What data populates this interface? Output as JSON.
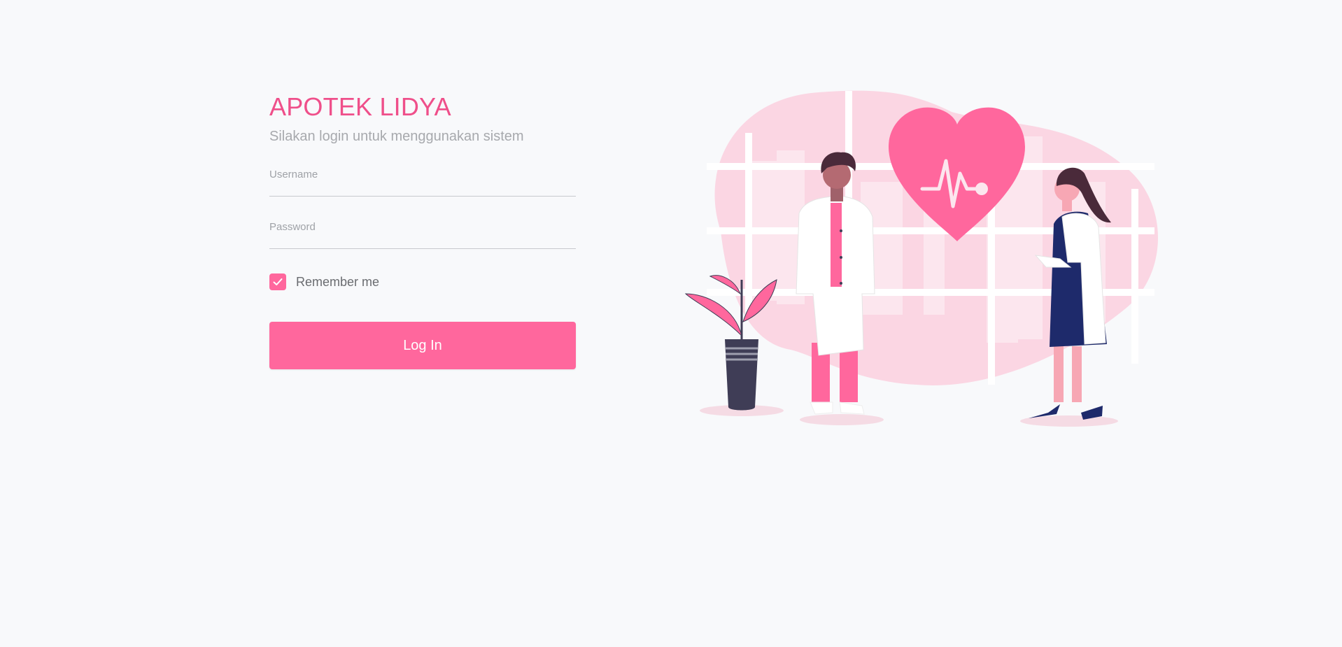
{
  "brand": {
    "title": "APOTEK LIDYA",
    "subtitle": "Silakan login untuk menggunakan sistem"
  },
  "form": {
    "username_label": "Username",
    "username_value": "",
    "password_label": "Password",
    "password_value": "",
    "remember_label": "Remember me",
    "remember_checked": true,
    "submit_label": "Log In"
  },
  "colors": {
    "accent": "#ff679d",
    "title": "#ef4f8a",
    "background": "#f8f9fb"
  },
  "illustration": {
    "icon": "doctors-heart-illustration"
  }
}
